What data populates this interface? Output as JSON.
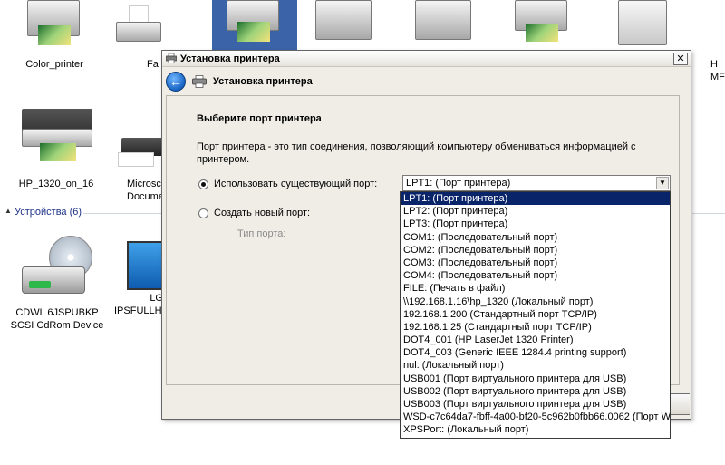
{
  "desktop": {
    "items": [
      {
        "label": "Color_printer"
      },
      {
        "label": "Fa"
      },
      {
        "label": "HP_1320_on_16"
      },
      {
        "label": "Microsc\nDocumen"
      },
      {
        "label": "CDWL 6JSPUBKP\nSCSI CdRom Device"
      },
      {
        "label": "LG\nIPSFULLHD"
      },
      {
        "label": "H\nMF"
      }
    ],
    "section_header": "Устройства (6)"
  },
  "dialog": {
    "title": "Установка принтера",
    "close_glyph": "✕",
    "back_glyph": "←",
    "header_title": "Установка принтера",
    "heading": "Выберите порт принтера",
    "description": "Порт принтера - это тип соединения, позволяющий компьютеру обмениваться информацией с принтером.",
    "use_existing_label": "Использовать существующий порт:",
    "create_new_label": "Создать новый порт:",
    "port_type_label": "Тип порта:",
    "combo_value": "LPT1: (Порт принтера)",
    "combo_arrow_glyph": "▼"
  },
  "dropdown": {
    "selected_index": 0,
    "options": [
      "LPT1: (Порт принтера)",
      "LPT2: (Порт принтера)",
      "LPT3: (Порт принтера)",
      "COM1: (Последовательный порт)",
      "COM2: (Последовательный порт)",
      "COM3: (Последовательный порт)",
      "COM4: (Последовательный порт)",
      "FILE: (Печать в файл)",
      "\\\\192.168.1.16\\hp_1320 (Локальный порт)",
      "192.168.1.200 (Стандартный порт TCP/IP)",
      "192.168.1.25 (Стандартный порт TCP/IP)",
      "DOT4_001 (HP LaserJet 1320 Printer)",
      "DOT4_003 (Generic IEEE 1284.4 printing support)",
      "nul: (Локальный порт)",
      "USB001 (Порт виртуального принтера для USB)",
      "USB002 (Порт виртуального принтера для USB)",
      "USB003 (Порт виртуального принтера для USB)",
      "WSD-c7c64da7-fbff-4a00-bf20-5c962b0fbb66.0062 (Порт W",
      "XPSPort: (Локальный порт)"
    ]
  },
  "colors": {
    "dialog_bg": "#efede6",
    "selection": "#0a246a"
  }
}
